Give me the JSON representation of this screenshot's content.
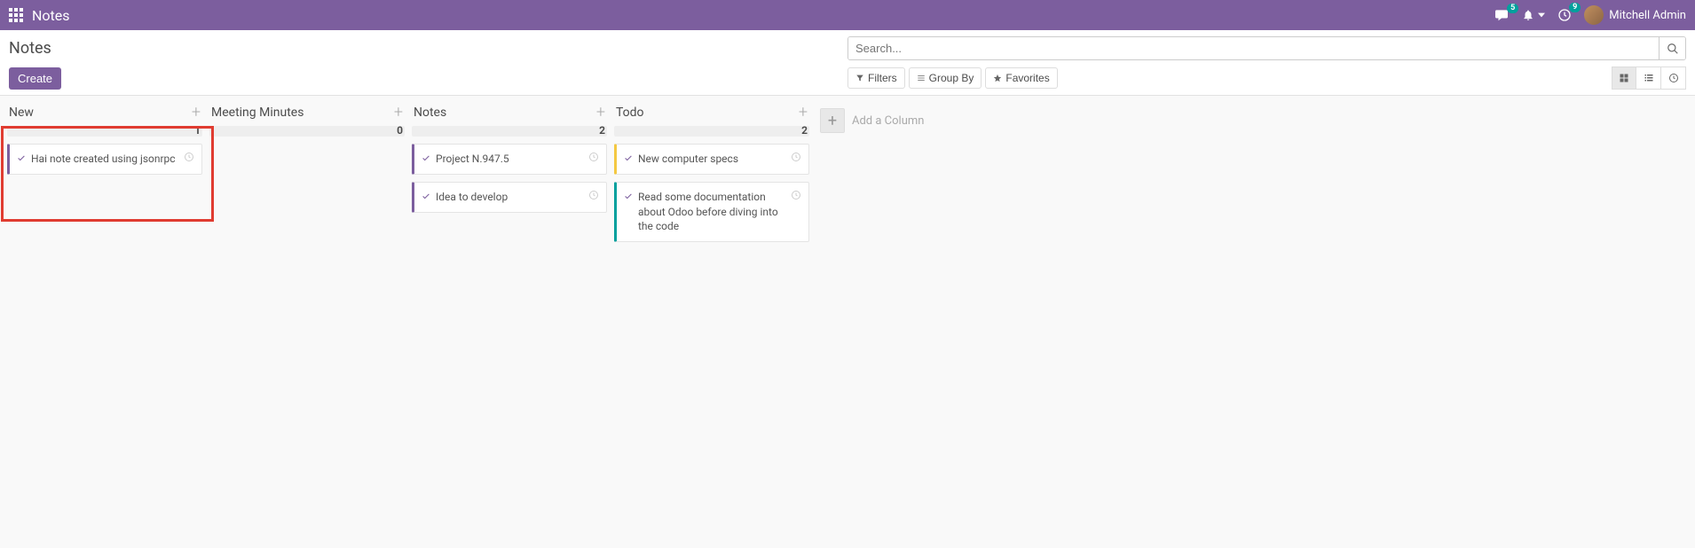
{
  "header": {
    "app_title": "Notes",
    "messages_badge": "5",
    "activities_badge": "9",
    "user_name": "Mitchell Admin"
  },
  "control_panel": {
    "breadcrumb": "Notes",
    "search_placeholder": "Search...",
    "create_label": "Create",
    "filters_label": "Filters",
    "groupby_label": "Group By",
    "favorites_label": "Favorites"
  },
  "kanban": {
    "add_column_label": "Add a Column",
    "columns": [
      {
        "title": "New",
        "count": "1",
        "cards": [
          {
            "text": "Hai note created using jsonrpc",
            "stripe": "purple"
          }
        ]
      },
      {
        "title": "Meeting Minutes",
        "count": "0",
        "cards": []
      },
      {
        "title": "Notes",
        "count": "2",
        "cards": [
          {
            "text": "Project N.947.5",
            "stripe": "purple"
          },
          {
            "text": "Idea to develop",
            "stripe": "purple"
          }
        ]
      },
      {
        "title": "Todo",
        "count": "2",
        "cards": [
          {
            "text": "New computer specs",
            "stripe": "yellow"
          },
          {
            "text": "Read some documentation about Odoo before diving into the code",
            "stripe": "teal"
          }
        ]
      }
    ]
  }
}
